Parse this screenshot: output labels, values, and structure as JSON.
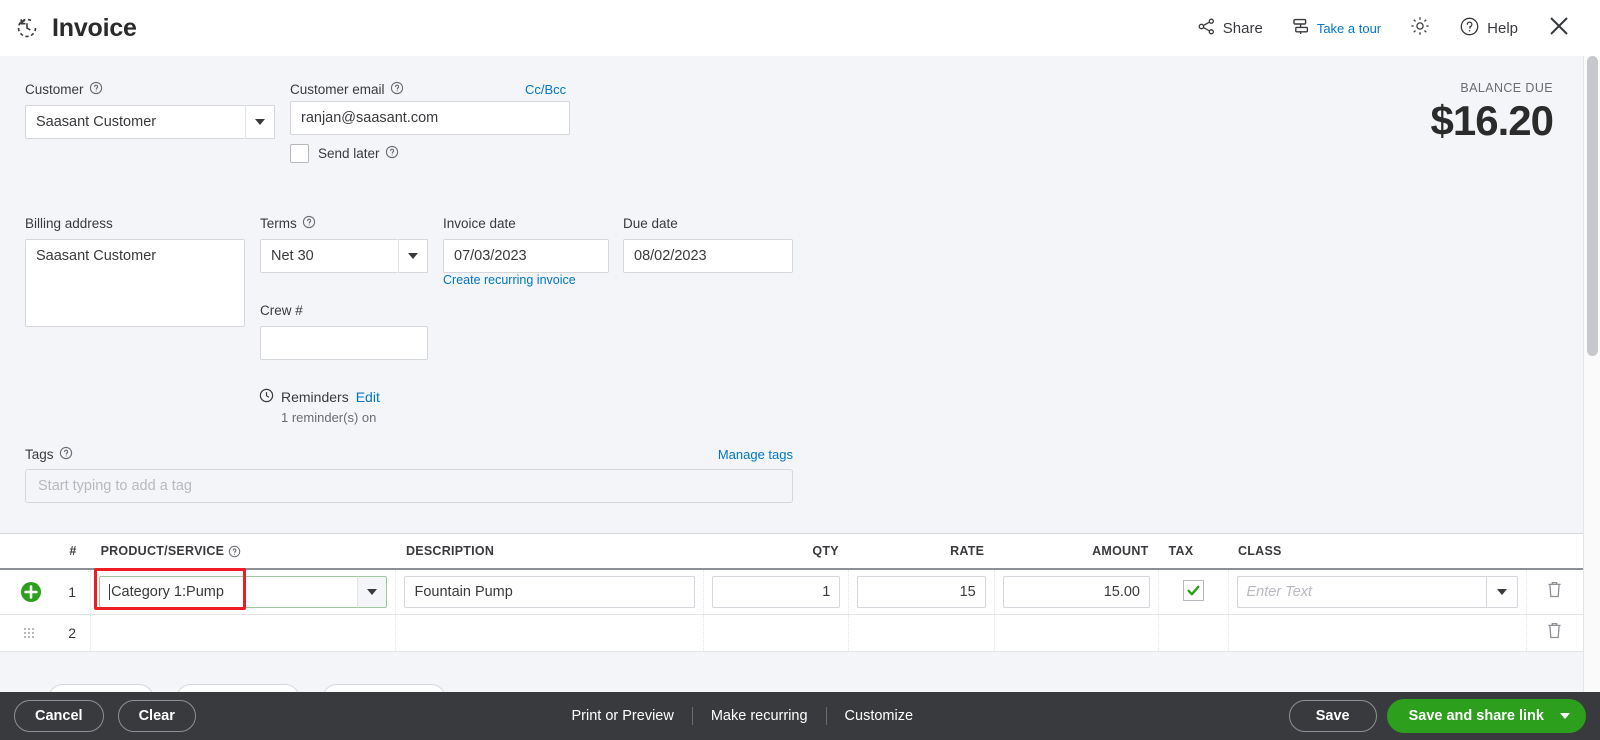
{
  "header": {
    "title": "Invoice",
    "title_icon": "clock-back-icon",
    "share_label": "Share",
    "share_icon": "share-icon",
    "tour_label": "Take a tour",
    "tour_icon": "tour-signpost-icon",
    "gear_icon": "gear-icon",
    "help_label": "Help",
    "help_icon": "question-circle-icon",
    "close_icon": "close-icon",
    "progress_color": "#8dd44a"
  },
  "form": {
    "customer_label": "Customer",
    "customer_value": "Saasant Customer",
    "customer_email_label": "Customer email",
    "customer_email_value": "ranjan@saasant.com",
    "ccbcc_label": "Cc/Bcc",
    "send_later_label": "Send later",
    "send_later_checked": false,
    "balance_due_label": "BALANCE DUE",
    "balance_due_amount": "$16.20",
    "billing_address_label": "Billing address",
    "billing_address_value": "Saasant Customer",
    "terms_label": "Terms",
    "terms_value": "Net 30",
    "invoice_date_label": "Invoice date",
    "invoice_date_value": "07/03/2023",
    "due_date_label": "Due date",
    "due_date_value": "08/02/2023",
    "create_recurring_label": "Create recurring invoice",
    "crew_label": "Crew #",
    "crew_value": "",
    "reminders_label": "Reminders",
    "reminders_edit_label": "Edit",
    "reminders_sub": "1 reminder(s) on",
    "tags_label": "Tags",
    "manage_tags_label": "Manage tags",
    "tags_placeholder": "Start typing to add a tag"
  },
  "items_table": {
    "columns": {
      "num": "#",
      "product_service": "PRODUCT/SERVICE",
      "description": "DESCRIPTION",
      "qty": "QTY",
      "rate": "RATE",
      "amount": "AMOUNT",
      "tax": "TAX",
      "class": "CLASS"
    },
    "rows": [
      {
        "num": "1",
        "product_service": "Category 1:Pump",
        "description": "Fountain Pump",
        "qty": "1",
        "rate": "15",
        "amount": "15.00",
        "tax_checked": true,
        "class_placeholder": "Enter Text",
        "highlighted": true,
        "highlight_color": "#ee1c25"
      },
      {
        "num": "2",
        "product_service": "",
        "description": "",
        "qty": "",
        "rate": "",
        "amount": "",
        "tax_checked": false,
        "class_placeholder": "",
        "highlighted": false
      }
    ]
  },
  "footer": {
    "cancel_label": "Cancel",
    "clear_label": "Clear",
    "print_preview_label": "Print or Preview",
    "make_recurring_label": "Make recurring",
    "customize_label": "Customize",
    "save_label": "Save",
    "save_share_label": "Save and share link",
    "accent_green": "#2ca01c"
  }
}
